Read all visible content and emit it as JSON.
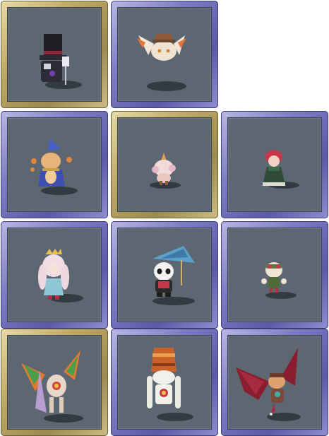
{
  "palette": {
    "slot_frame_purple": "#7e7dc4",
    "slot_frame_gold": "#bfa968",
    "slot_background": "#5c6771"
  },
  "rows": [
    {
      "slots": [
        {
          "frame": "gold",
          "icon": "top-hat-gentleman-costume-icon"
        },
        {
          "frame": "purple",
          "icon": "winged-cat-with-hat-pet-icon"
        }
      ]
    },
    {
      "slots": [
        {
          "frame": "purple",
          "icon": "wizard-fox-pet-icon"
        },
        {
          "frame": "gold",
          "icon": "unicorn-creature-pet-icon"
        },
        {
          "frame": "purple",
          "icon": "red-haired-girl-costume-icon"
        }
      ]
    },
    {
      "slots": [
        {
          "frame": "purple",
          "icon": "white-haired-princess-costume-icon"
        },
        {
          "frame": "purple",
          "icon": "panda-with-umbrella-costume-icon"
        },
        {
          "frame": "purple",
          "icon": "goggles-creature-pet-icon"
        }
      ]
    },
    {
      "slots": [
        {
          "frame": "gold",
          "icon": "winged-dragon-creature-pet-icon"
        },
        {
          "frame": "purple",
          "icon": "tall-hat-bunny-costume-icon"
        },
        {
          "frame": "purple",
          "icon": "bat-winged-dragon-pet-icon"
        }
      ]
    }
  ]
}
